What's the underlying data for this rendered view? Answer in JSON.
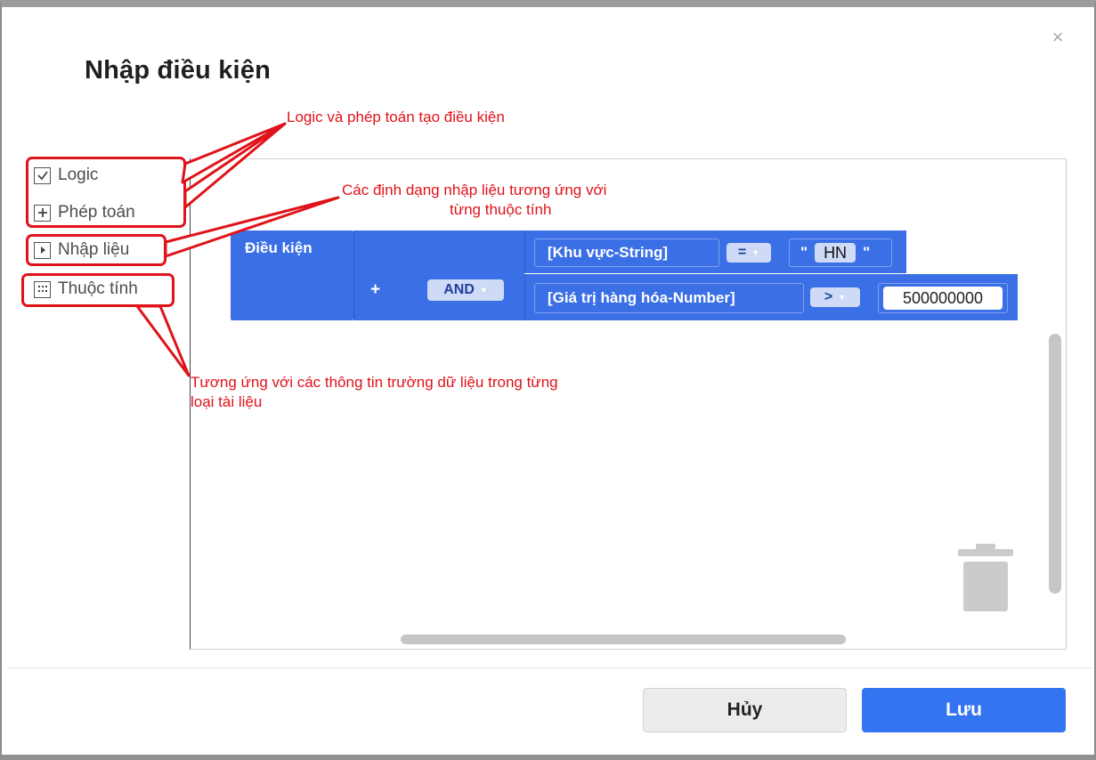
{
  "dialog": {
    "title": "Nhập điều kiện",
    "close_symbol": "×"
  },
  "toolbox": {
    "items": [
      {
        "label": "Logic",
        "icon": "checkbox-icon"
      },
      {
        "label": "Phép toán",
        "icon": "plus-box-icon"
      },
      {
        "label": "Nhập liệu",
        "icon": "play-box-icon"
      },
      {
        "label": "Thuộc tính",
        "icon": "grid-box-icon"
      }
    ]
  },
  "annotations": {
    "logic": "Logic và phép toán tạo điều kiện",
    "input_line1": "Các định dạng nhập liệu tương ứng với",
    "input_line2": "từng thuộc tính",
    "attr_line1": "Tương ứng với các thông tin trường dữ liệu trong từng",
    "attr_line2": "loại tài liệu"
  },
  "blocks": {
    "condition_label": "Điều kiện",
    "plus": "+",
    "operator": "AND",
    "row1": {
      "field": "[Khu vực-String]",
      "comparator": "=",
      "quote_open": "\"",
      "value": "HN",
      "quote_close": "\""
    },
    "row2": {
      "field": "[Giá trị hàng hóa-Number]",
      "comparator": ">",
      "value": "500000000"
    }
  },
  "footer": {
    "cancel_label": "Hủy",
    "save_label": "Lưu"
  },
  "colors": {
    "block_blue": "#3b6fe6",
    "save_blue": "#3474f0",
    "annotation_red": "#e0121a"
  }
}
